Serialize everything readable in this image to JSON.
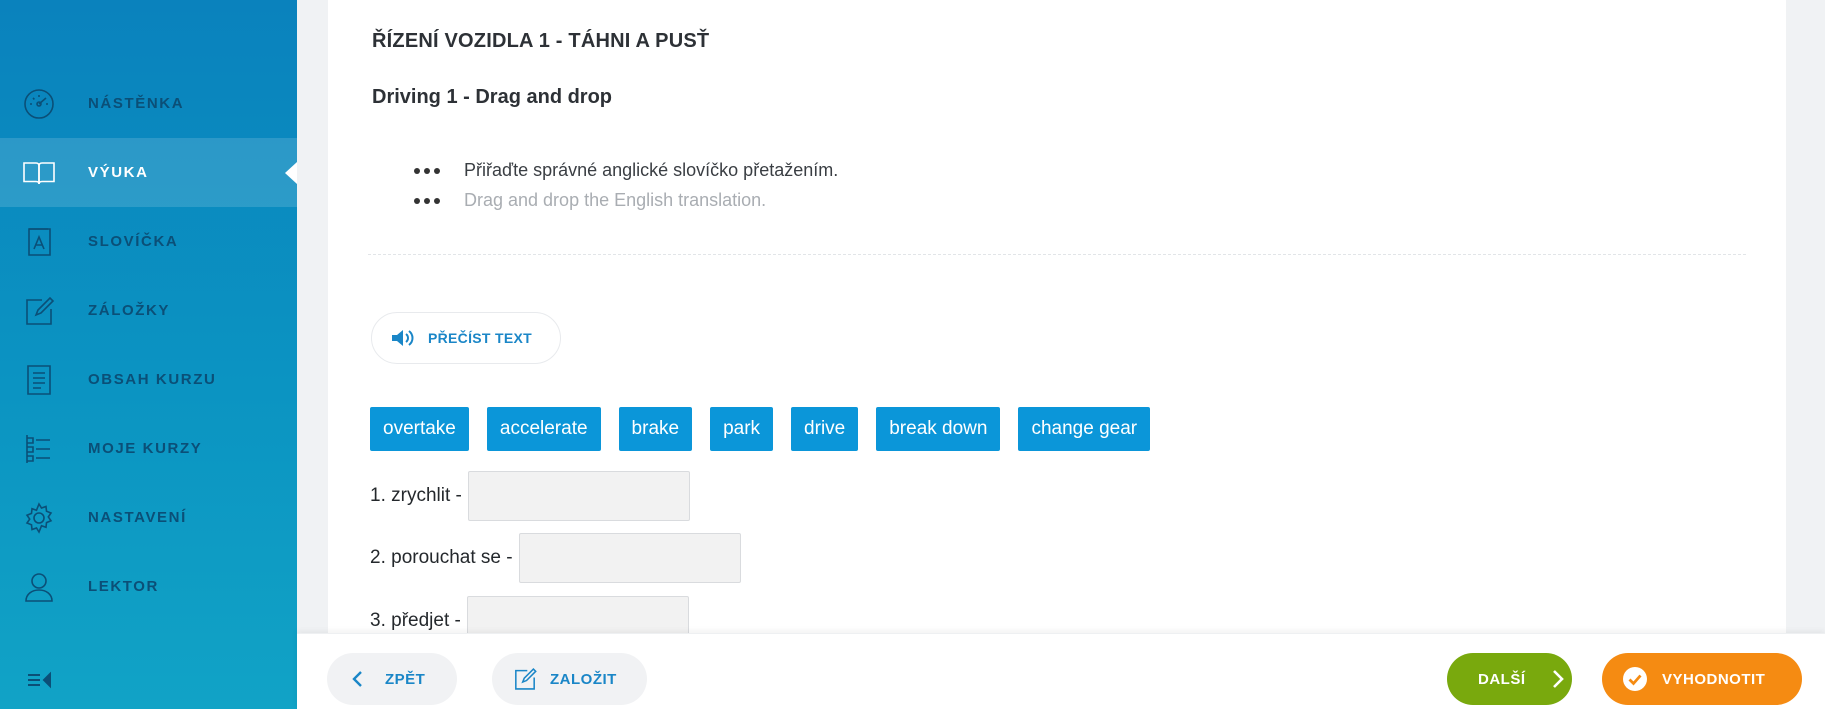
{
  "sidebar": {
    "items": [
      {
        "label": "NÁSTĚNKA",
        "icon": "dashboard-gauge-icon",
        "active": false
      },
      {
        "label": "VÝUKA",
        "icon": "open-book-icon",
        "active": true
      },
      {
        "label": "SLOVÍČKA",
        "icon": "dictionary-a-icon",
        "active": false
      },
      {
        "label": "ZÁLOŽKY",
        "icon": "edit-note-icon",
        "active": false
      },
      {
        "label": "OBSAH KURZU",
        "icon": "document-list-icon",
        "active": false
      },
      {
        "label": "MOJE KURZY",
        "icon": "course-list-icon",
        "active": false
      },
      {
        "label": "NASTAVENÍ",
        "icon": "gear-icon",
        "active": false
      },
      {
        "label": "LEKTOR",
        "icon": "user-icon",
        "active": false
      }
    ],
    "collapse_icon": "collapse-menu-icon"
  },
  "lesson": {
    "title_cz": "ŘÍZENÍ VOZIDLA 1 - TÁHNI A PUSŤ",
    "title_en": "Driving 1 - Drag and drop",
    "instruction_cz": "Přiřaďte správné anglické slovíčko přetažením.",
    "instruction_en": "Drag and drop the English translation.",
    "read_button": "PŘEČÍST TEXT",
    "word_bank": [
      "overtake",
      "accelerate",
      "brake",
      "park",
      "drive",
      "break down",
      "change gear"
    ],
    "questions": [
      {
        "label": "1. zrychlit -",
        "answer": ""
      },
      {
        "label": "2. porouchat se -",
        "answer": ""
      },
      {
        "label": "3. předjet -",
        "answer": ""
      }
    ]
  },
  "footer": {
    "back_label": "ZPĚT",
    "bookmark_label": "ZALOŽIT",
    "next_label": "DALŠÍ",
    "evaluate_label": "VYHODNOTIT"
  },
  "colors": {
    "sidebar_top": "#0a82bd",
    "sidebar_bottom": "#11a3c6",
    "chip": "#0b96d9",
    "accent_blue": "#1a86c7",
    "next_green": "#79a90d",
    "evaluate_orange": "#f58b12"
  }
}
